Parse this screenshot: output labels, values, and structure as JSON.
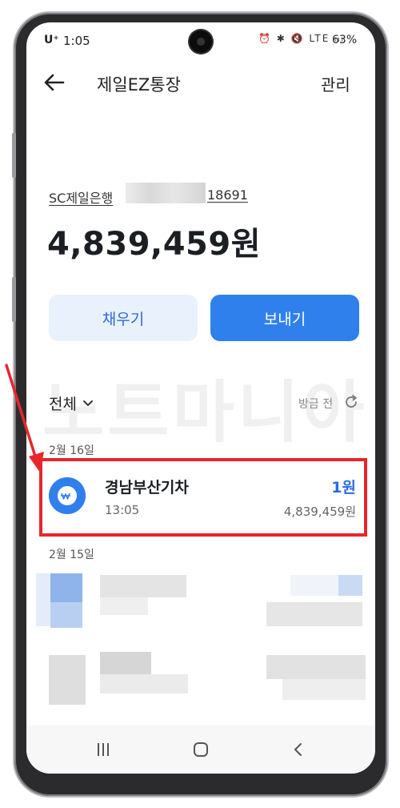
{
  "status_bar": {
    "carrier": "U⁺",
    "time": "1:05",
    "icons": "⏰ ✱ 🔇 LTE ᵢₗₗ",
    "battery": "63%"
  },
  "header": {
    "title": "제일EZ통장",
    "manage_label": "관리"
  },
  "account": {
    "name": "SC제일은행",
    "number_suffix": "18691",
    "balance": "4,839,459원"
  },
  "actions": {
    "fill_label": "채우기",
    "send_label": "보내기"
  },
  "watermark": "노트마니아",
  "filter": {
    "label": "전체",
    "refresh_label": "방금 전"
  },
  "groups": [
    {
      "date": "2월 16일"
    },
    {
      "date": "2월 15일"
    }
  ],
  "transaction": {
    "name": "경남부산기차",
    "time": "13:05",
    "amount": "1원",
    "balance_after": "4,839,459원"
  },
  "colors": {
    "accent": "#2f80ed",
    "highlight_border": "#e8262c",
    "amount": "#2b6be0"
  }
}
